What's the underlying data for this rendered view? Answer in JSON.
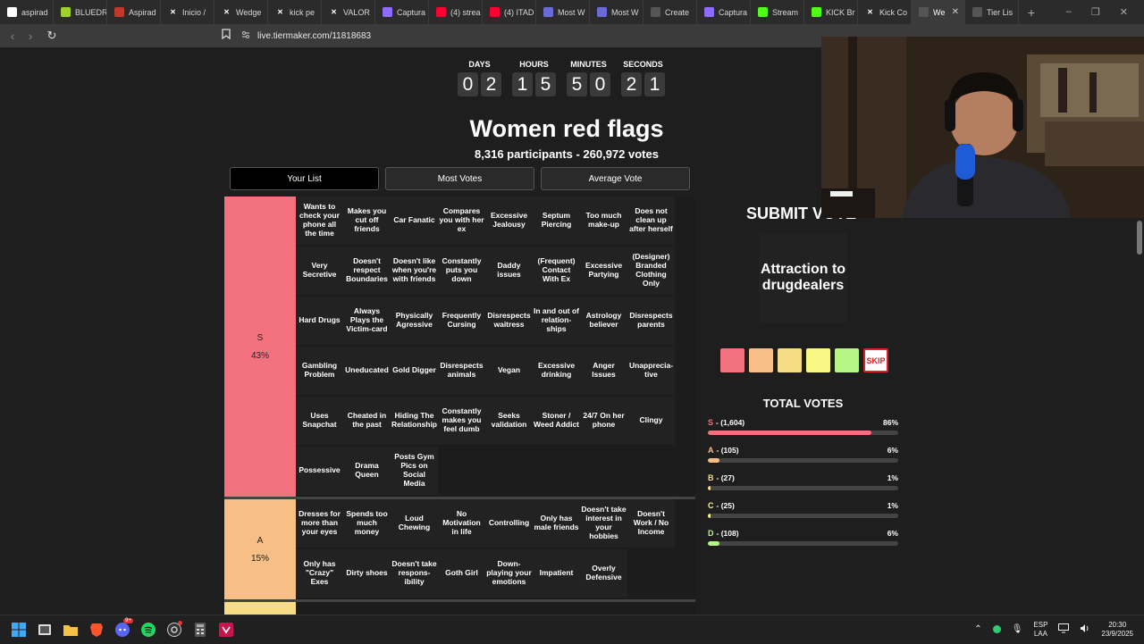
{
  "browser": {
    "tabs": [
      {
        "label": "aspirad",
        "icon": "google-icon",
        "color": "#ffffff"
      },
      {
        "label": "BLUEDR",
        "icon": "bluedr-icon",
        "color": "#9ed12c"
      },
      {
        "label": "Aspirad",
        "icon": "aspirad-icon",
        "color": "#c0392b"
      },
      {
        "label": "Inicio /",
        "icon": "x-icon",
        "color": "#000000"
      },
      {
        "label": "Wedge",
        "icon": "x-icon",
        "color": "#000000"
      },
      {
        "label": "kick pe",
        "icon": "x-icon",
        "color": "#000000"
      },
      {
        "label": "VALOR",
        "icon": "x-icon",
        "color": "#000000"
      },
      {
        "label": "Captura",
        "icon": "feather-icon",
        "color": "#8e6cff"
      },
      {
        "label": "(4) strea",
        "icon": "youtube-icon",
        "color": "#ff0033"
      },
      {
        "label": "(4) ITAD",
        "icon": "youtube-icon",
        "color": "#ff0033"
      },
      {
        "label": "Most W",
        "icon": "globe-icon",
        "color": "#6b6bd6"
      },
      {
        "label": "Most W",
        "icon": "globe-icon",
        "color": "#6b6bd6"
      },
      {
        "label": "Create",
        "icon": "tiermaker-icon",
        "color": "#555555"
      },
      {
        "label": "Captura",
        "icon": "feather-icon",
        "color": "#8e6cff"
      },
      {
        "label": "Stream",
        "icon": "kick-icon",
        "color": "#53fc18"
      },
      {
        "label": "KICK Br",
        "icon": "kick-icon",
        "color": "#53fc18"
      },
      {
        "label": "Kick Co",
        "icon": "x-icon",
        "color": "#000000"
      },
      {
        "label": "We",
        "icon": "tiermaker-icon",
        "color": "#555555",
        "active": true
      },
      {
        "label": "Tier Lis",
        "icon": "tiermaker-icon",
        "color": "#555555"
      }
    ],
    "url": "live.tiermaker.com/11818683"
  },
  "countdown": {
    "units": [
      {
        "label": "DAYS",
        "digits": [
          "0",
          "2"
        ]
      },
      {
        "label": "HOURS",
        "digits": [
          "1",
          "5"
        ]
      },
      {
        "label": "MINUTES",
        "digits": [
          "5",
          "0"
        ]
      },
      {
        "label": "SECONDS",
        "digits": [
          "2",
          "1"
        ]
      }
    ]
  },
  "title": "Women red flags",
  "subtitle": "8,316 participants - 260,972 votes",
  "list_tabs": [
    {
      "label": "Your List",
      "active": true
    },
    {
      "label": "Most Votes",
      "active": false
    },
    {
      "label": "Average Vote",
      "active": false
    }
  ],
  "tiers": [
    {
      "name": "S",
      "percent": "43%",
      "color": "#f4727f",
      "items": [
        "Wants to check your phone all the time",
        "Makes you cut off friends",
        "Car Fanatic",
        "Compares you with her ex",
        "Excessive Jealousy",
        "Septum Piercing",
        "Too much make-up",
        "Does not clean up after herself",
        "Very Secretive",
        "Doesn't respect Boundaries",
        "Doesn't like when you're with friends",
        "Constantly puts you down",
        "Daddy issues",
        "(Frequent) Contact With Ex",
        "Excessive Partying",
        "(Designer) Branded Clothing Only",
        "Hard Drugs",
        "Always Plays the Victim-card",
        "Physically Agressive",
        "Frequently Cursing",
        "Disrespects waitress",
        "In and out of relation-ships",
        "Astrology believer",
        "Disrespects parents",
        "Gambling Problem",
        "Uneducated",
        "Gold Digger",
        "Disrespects animals",
        "Vegan",
        "Excessive drinking",
        "Anger Issues",
        "Unapprecia-tive",
        "Uses Snapchat",
        "Cheated in the past",
        "Hiding The Relationship",
        "Constantly makes you feel dumb",
        "Seeks validation",
        "Stoner / Weed Addict",
        "24/7 On her phone",
        "Clingy",
        "Possessive",
        "Drama Queen",
        "Posts Gym Pics on Social Media"
      ]
    },
    {
      "name": "A",
      "percent": "15%",
      "color": "#f7be86",
      "items": [
        "Dresses for more than your eyes",
        "Spends too much money",
        "Loud Chewing",
        "No Motivation in life",
        "Controlling",
        "Only has male friends",
        "Doesn't take interest in your hobbies",
        "Doesn't Work / No Income",
        "Only has \"Crazy\" Exes",
        "Dirty shoes",
        "Doesn't take respons-ibility",
        "Goth Girl",
        "Down-playing your emotions",
        "Impatient",
        "Overly Defensive"
      ]
    },
    {
      "name": "",
      "percent": "",
      "color": "#f7dc86",
      "items": []
    }
  ],
  "vote_panel": {
    "submit_label": "SUBMIT VOTE",
    "current_item": "Attraction to drugdealers",
    "buttons": [
      {
        "tier": "S",
        "color": "#f4727f"
      },
      {
        "tier": "A",
        "color": "#f7be86"
      },
      {
        "tier": "B",
        "color": "#f7dc86"
      },
      {
        "tier": "C",
        "color": "#f9f887"
      },
      {
        "tier": "D",
        "color": "#b6f586"
      }
    ],
    "skip_label": "SKIP",
    "total_votes_title": "TOTAL VOTES",
    "results": [
      {
        "tier": "S",
        "count": "- (1,604)",
        "percent": "86%",
        "fraction": 0.86,
        "color": "#f4727f"
      },
      {
        "tier": "A",
        "count": "- (105)",
        "percent": "6%",
        "fraction": 0.06,
        "color": "#f7be86"
      },
      {
        "tier": "B",
        "count": "- (27)",
        "percent": "1%",
        "fraction": 0.015,
        "color": "#f7dc86"
      },
      {
        "tier": "C",
        "count": "- (25)",
        "percent": "1%",
        "fraction": 0.015,
        "color": "#f9f887"
      },
      {
        "tier": "D",
        "count": "- (108)",
        "percent": "6%",
        "fraction": 0.06,
        "color": "#b6f586"
      }
    ]
  },
  "taskbar": {
    "icons": [
      "windows-start-icon",
      "task-view-icon",
      "file-explorer-icon",
      "brave-icon",
      "discord-icon",
      "spotify-icon",
      "obs-icon",
      "calculator-icon",
      "app-icon"
    ],
    "discord_badge": "9+",
    "lang_line1": "ESP",
    "lang_line2": "LAA",
    "time": "20:30",
    "date": "23/9/2025"
  }
}
